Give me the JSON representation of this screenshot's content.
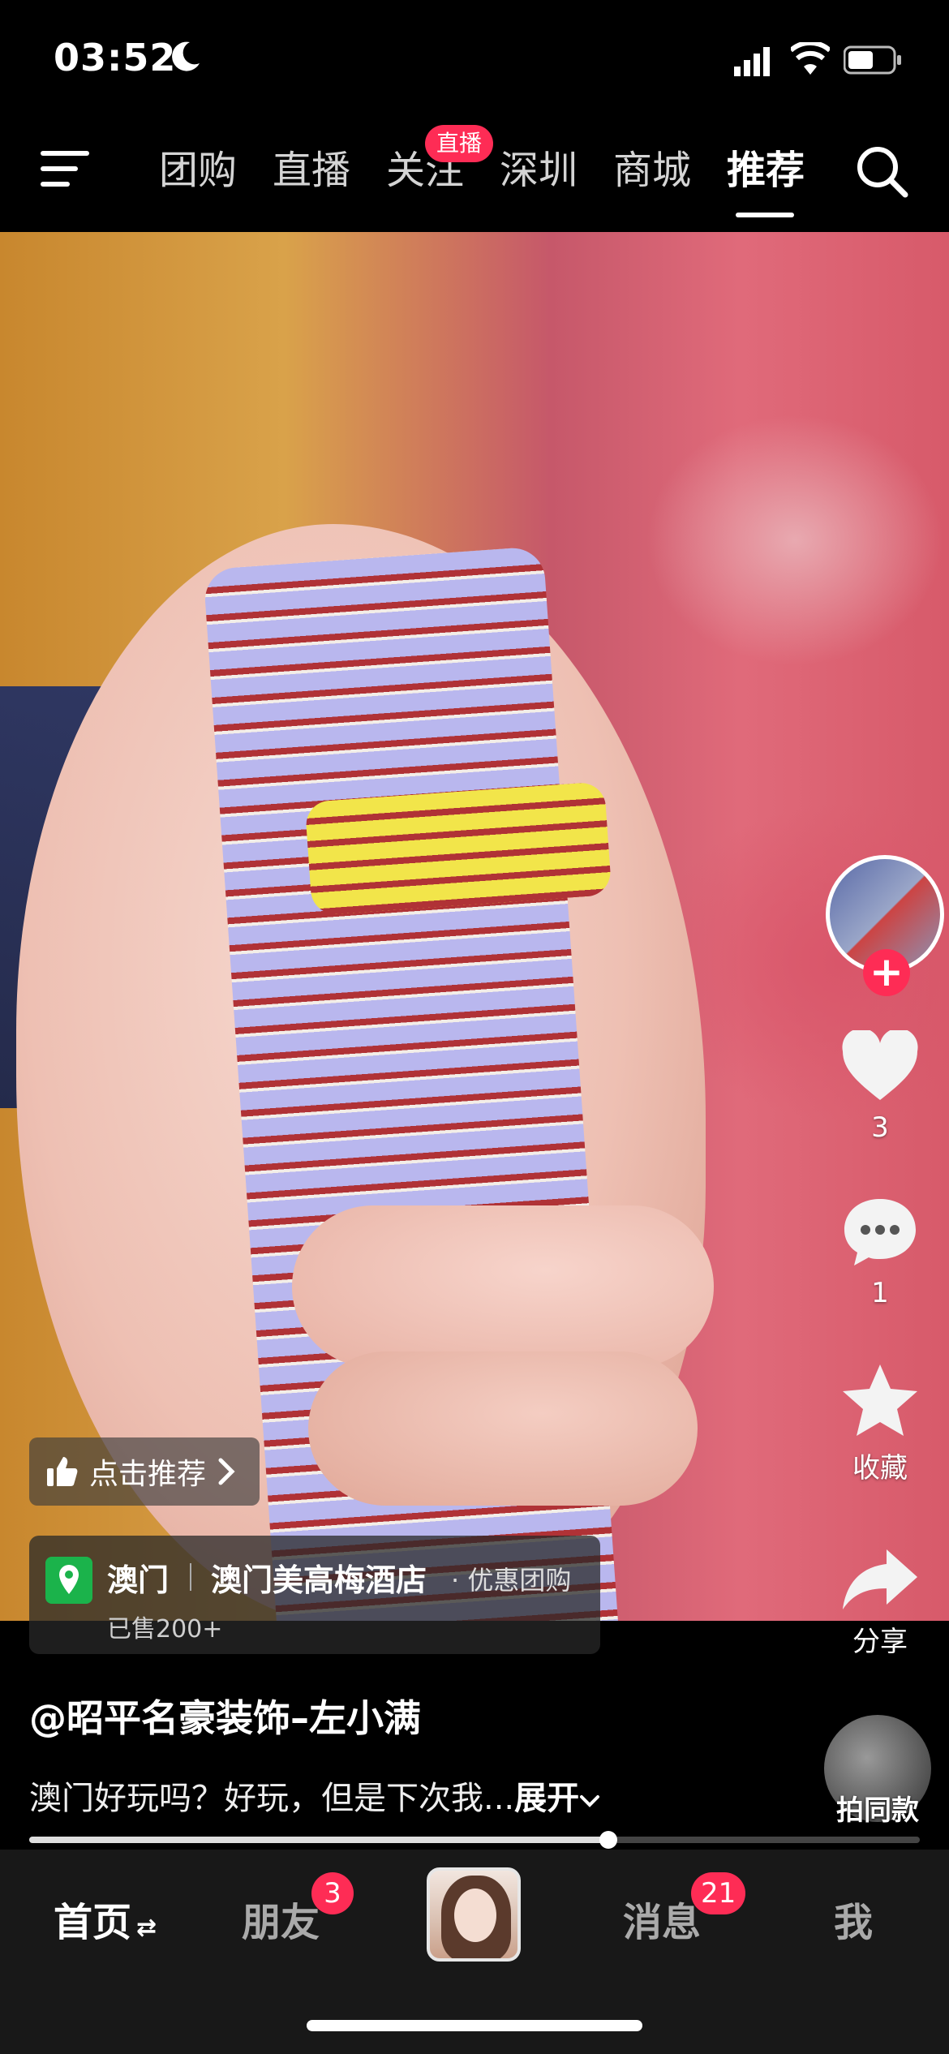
{
  "status": {
    "time": "03:52"
  },
  "topnav": {
    "tabs": [
      "团购",
      "直播",
      "关注",
      "深圳",
      "商城",
      "推荐"
    ],
    "active_tab": "推荐",
    "live_badge": "直播"
  },
  "video": {
    "recommend_label": "点击推荐",
    "location": {
      "city": "澳门",
      "hotel": "澳门美高梅酒店",
      "deal": "· 优惠团购",
      "sold": "已售200+"
    },
    "author": "@昭平名豪装饰–左小满",
    "caption": "澳门好玩吗？好玩，但是下次我...",
    "expand_label": "展开",
    "progress": 0.65
  },
  "rail": {
    "likes": "3",
    "comments": "1",
    "favorite_label": "收藏",
    "share_label": "分享",
    "same_style_label": "拍同款"
  },
  "bottomnav": {
    "home": "首页",
    "friends": "朋友",
    "friends_badge": "3",
    "messages": "消息",
    "messages_badge": "21",
    "me": "我"
  },
  "colors": {
    "accent": "#fe2c55",
    "location_green": "#1bb34b"
  }
}
